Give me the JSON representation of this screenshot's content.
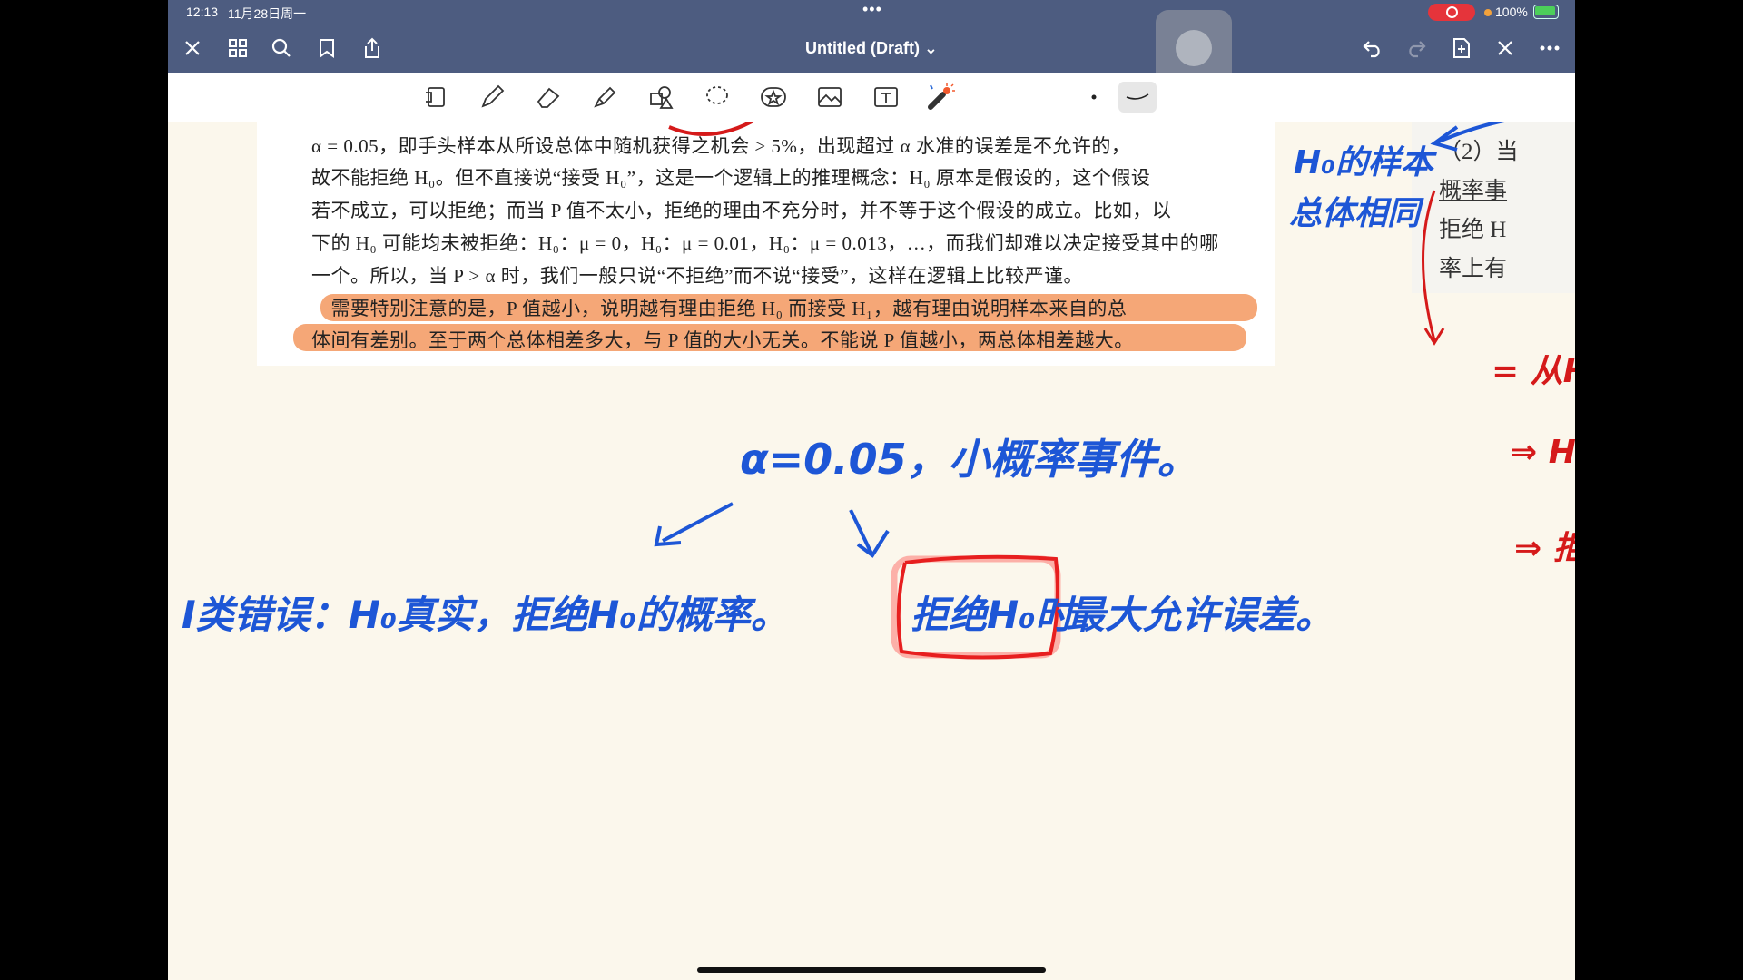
{
  "status_bar": {
    "time": "12:13",
    "date": "11月28日周一",
    "dots": "•••",
    "battery": "100%"
  },
  "nav": {
    "title": "Untitled (Draft) ⌄"
  },
  "toolbar": {
    "icons": [
      "page-layout-icon",
      "pen-icon",
      "eraser-icon",
      "highlighter-icon",
      "shapes-icon",
      "lasso-icon",
      "sticker-icon",
      "image-icon",
      "text-box-icon",
      "laser-pointer-icon",
      "dot-size-icon",
      "stroke-style-icon"
    ]
  },
  "pdf": {
    "lines": [
      "α = 0.05，即手头样本从所设总体中随机获得之机会 > 5%，出现超过 α 水准的误差是不允许的，",
      "故不能拒绝 H₀。但不直接说“接受 H₀”，这是一个逻辑上的推理概念：H₀ 原本是假设的，这个假设",
      "若不成立，可以拒绝；而当 P 值不太小，拒绝的理由不充分时，并不等于这个假设的成立。比如，以",
      "下的 H₀ 可能均未被拒绝：H₀：μ = 0，H₀：μ = 0.01，H₀：μ = 0.013，…，而我们却难以决定接受其中的哪",
      "一个。所以，当 P > α 时，我们一般只说“不拒绝”而不说“接受”，这样在逻辑上比较严谨。",
      "　需要特别注意的是，P 值越小，说明越有理由拒绝 H₀ 而接受 H₁，越有理由说明样本来自的总",
      "体间有差别。至于两个总体相差多大，与 P 值的大小无关。不能说 P 值越小，两总体相差越大。"
    ]
  },
  "side_pdf": {
    "lines": [
      "（2）当",
      "概率事",
      "拒绝 H",
      "率上有"
    ]
  },
  "handwriting": {
    "note_top_right": [
      "H₀的样本",
      "总体相同"
    ],
    "alpha_note": "α=0.05，小概率事件。",
    "type1_error": "I类错误：H₀真实，拒绝H₀的概率。",
    "boxed": "拒绝H₀时",
    "max_error": "最大允许误差。",
    "red_right": [
      "= 从H",
      "⇒ H",
      "⇒ 拒"
    ]
  },
  "colors": {
    "nav_bg": "#4d5c80",
    "ink_blue": "#1d56d6",
    "ink_red": "#d51a1a",
    "highlight": "#f5a777",
    "paper": "#fbf7ec"
  }
}
